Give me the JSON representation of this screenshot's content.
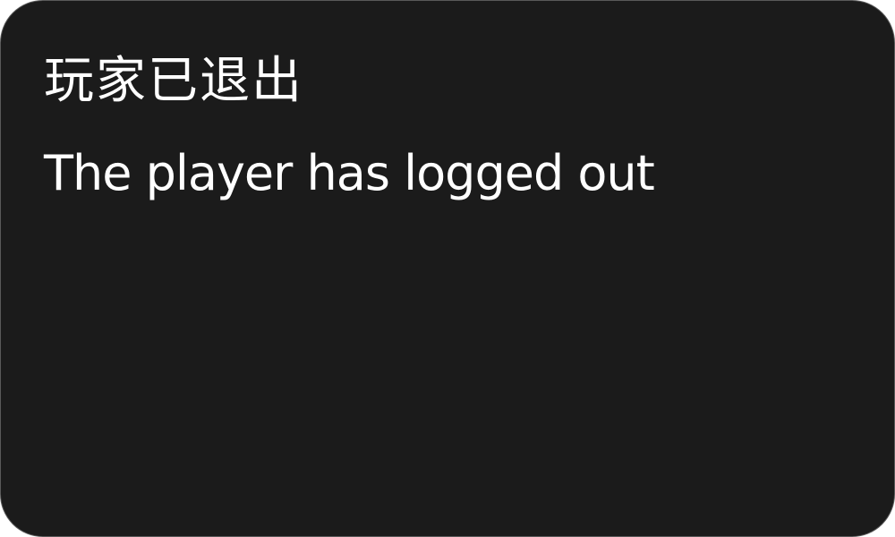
{
  "notice": {
    "title_cn": "玩家已退出",
    "message_en": "The player has logged out"
  },
  "colors": {
    "background": "#1b1b1b",
    "text": "#ffffff",
    "border": "#5a5a5a"
  }
}
